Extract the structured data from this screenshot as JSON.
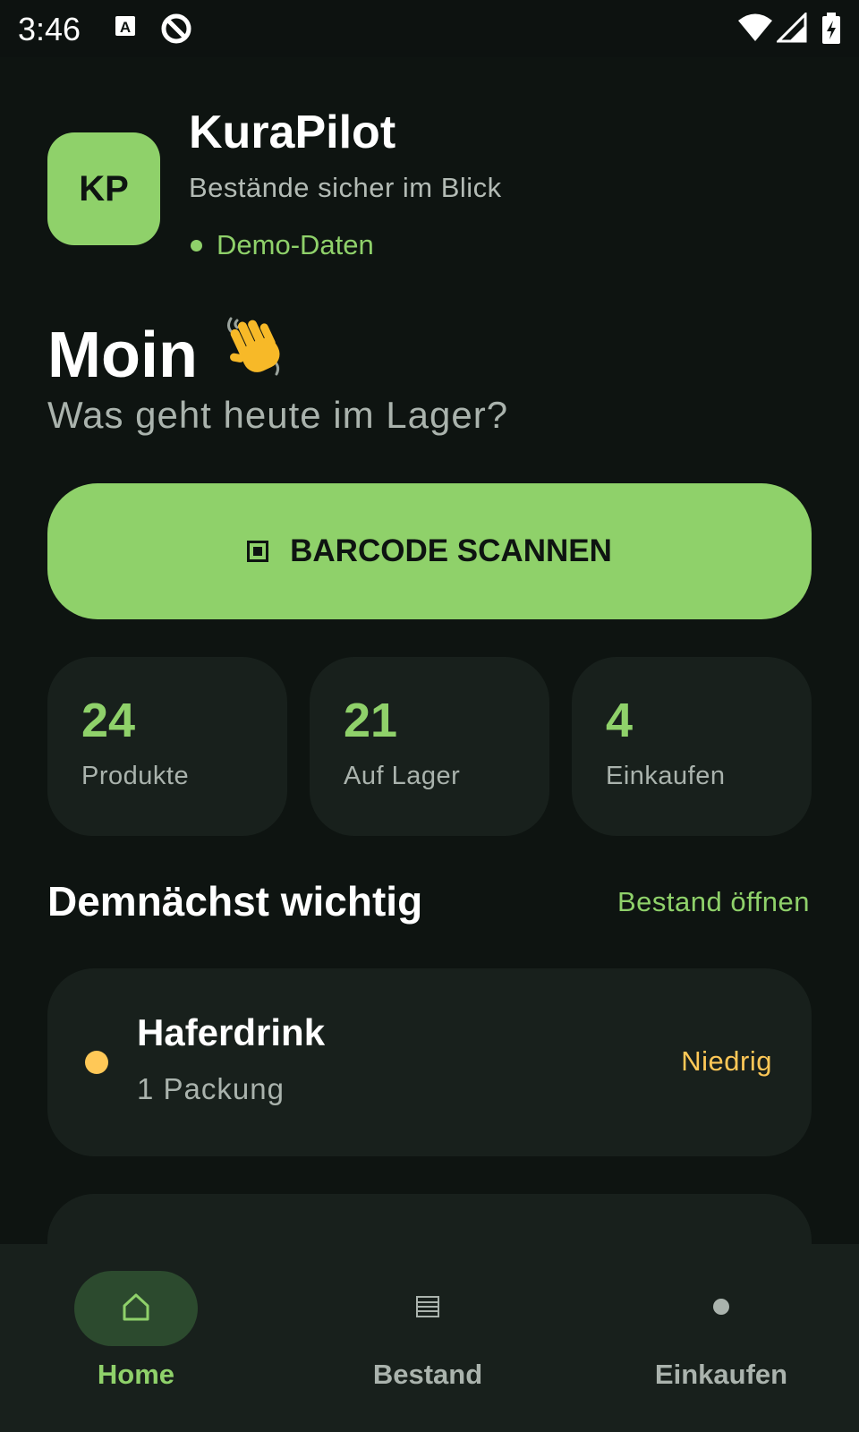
{
  "status_bar": {
    "time": "3:46",
    "icons": [
      "text-a-icon",
      "no-sync-icon",
      "wifi-icon",
      "signal-icon",
      "battery-charging-icon"
    ]
  },
  "header": {
    "logo_initials": "KP",
    "title": "KuraPilot",
    "subtitle": "Bestände sicher im Blick",
    "demo_label": "Demo-Daten"
  },
  "greeting": {
    "title": "Moin",
    "emoji": "👋",
    "question": "Was geht heute im Lager?"
  },
  "scan_button": {
    "label": "BARCODE SCANNEN",
    "icon": "barcode-scan-icon"
  },
  "stats": [
    {
      "value": "24",
      "label": "Produkte"
    },
    {
      "value": "21",
      "label": "Auf Lager"
    },
    {
      "value": "4",
      "label": "Einkaufen"
    }
  ],
  "section": {
    "title": "Demnächst wichtig",
    "link": "Bestand öffnen"
  },
  "items": [
    {
      "name": "Haferdrink",
      "quantity": "1 Packung",
      "status": "Niedrig",
      "status_color": "#ffc857"
    }
  ],
  "nav": [
    {
      "label": "Home",
      "icon": "home-icon",
      "active": true
    },
    {
      "label": "Bestand",
      "icon": "list-icon",
      "active": false
    },
    {
      "label": "Einkaufen",
      "icon": "dot-icon",
      "active": false
    }
  ],
  "colors": {
    "background": "#0e1411",
    "accent": "#8fd16a",
    "card": "#18201c",
    "warning": "#ffc857"
  }
}
